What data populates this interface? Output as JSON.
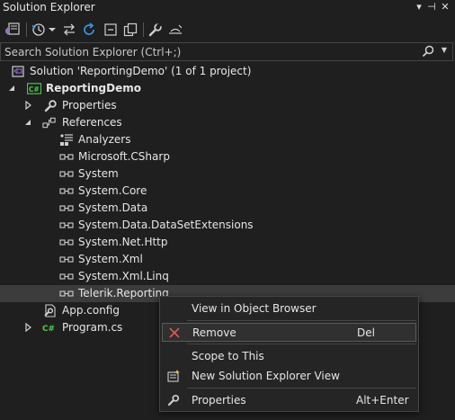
{
  "window": {
    "title": "Solution Explorer",
    "buttons": {
      "dropdown": "▾",
      "pin": "⊣",
      "close": "✕"
    }
  },
  "toolbar": {
    "items": [
      "vs-switch-views-icon",
      "history-icon",
      "dropdown-arrow",
      "sync-icon",
      "refresh-icon",
      "collapse-all-icon",
      "show-all-files-icon",
      "properties-wrench-icon",
      "preview-selected-icon"
    ]
  },
  "search": {
    "placeholder": "Search Solution Explorer (Ctrl+;)",
    "value": ""
  },
  "tree": {
    "solution": "Solution 'ReportingDemo' (1 of 1 project)",
    "project": "ReportingDemo",
    "properties": "Properties",
    "references": "References",
    "analyzers": "Analyzers",
    "refs": [
      "Microsoft.CSharp",
      "System",
      "System.Core",
      "System.Data",
      "System.Data.DataSetExtensions",
      "System.Net.Http",
      "System.Xml",
      "System.Xml.Linq",
      "Telerik.Reporting"
    ],
    "app_config": "App.config",
    "program_cs": "Program.cs"
  },
  "context_menu": {
    "view_object_browser": "View in Object Browser",
    "remove": "Remove",
    "remove_shortcut": "Del",
    "scope_to_this": "Scope to This",
    "new_view": "New Solution Explorer View",
    "properties": "Properties",
    "properties_shortcut": "Alt+Enter"
  },
  "colors": {
    "background": "#1f1f1f",
    "text": "#e6e6e6",
    "selected_row": "#3c3c3c",
    "menu_background": "#252526",
    "csharp_green": "#4ec94e",
    "vs_purple": "#9b6bd9",
    "accent_blue": "#3c9cf0",
    "remove_red": "#e05555"
  }
}
